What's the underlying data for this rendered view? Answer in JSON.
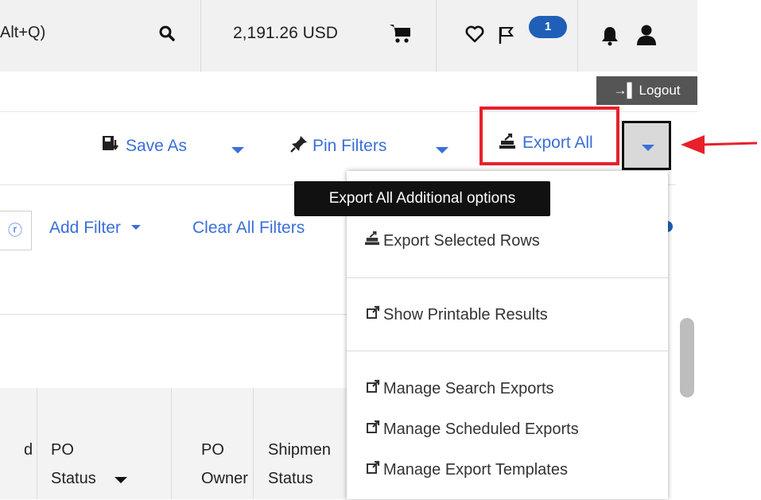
{
  "topbar": {
    "search_fragment": "Alt+Q)",
    "balance": "2,191.26 USD",
    "notification_count": "1"
  },
  "logout": {
    "label": "Logout"
  },
  "toolbar": {
    "save_as": "Save As",
    "pin_filters": "Pin Filters",
    "export_all": "Export All"
  },
  "tooltip": "Export All Additional options",
  "filters": {
    "add_filter": "Add Filter",
    "clear_all": "Clear All Filters"
  },
  "table": {
    "columns": [
      "d",
      "PO Status",
      "PO Owner",
      "Shipment Status"
    ],
    "col_d": "d",
    "po_status_1": "PO",
    "po_status_2": "Status",
    "po_owner_1": "PO",
    "po_owner_2": "Owner",
    "ship_1": "Shipmen",
    "ship_2": "Status"
  },
  "menu": {
    "items": [
      {
        "label": "Export Selected Rows",
        "icon": "export-icon"
      },
      {
        "label": "Show Printable Results",
        "icon": "external-link-icon"
      },
      {
        "label": "Manage Search Exports",
        "icon": "external-link-icon"
      },
      {
        "label": "Manage Scheduled Exports",
        "icon": "external-link-icon"
      },
      {
        "label": "Manage Export Templates",
        "icon": "external-link-icon"
      }
    ]
  },
  "colors": {
    "link": "#3a6fd8",
    "highlight": "#e8202a",
    "badge": "#1f5fb8",
    "logout_bg": "#555555"
  }
}
